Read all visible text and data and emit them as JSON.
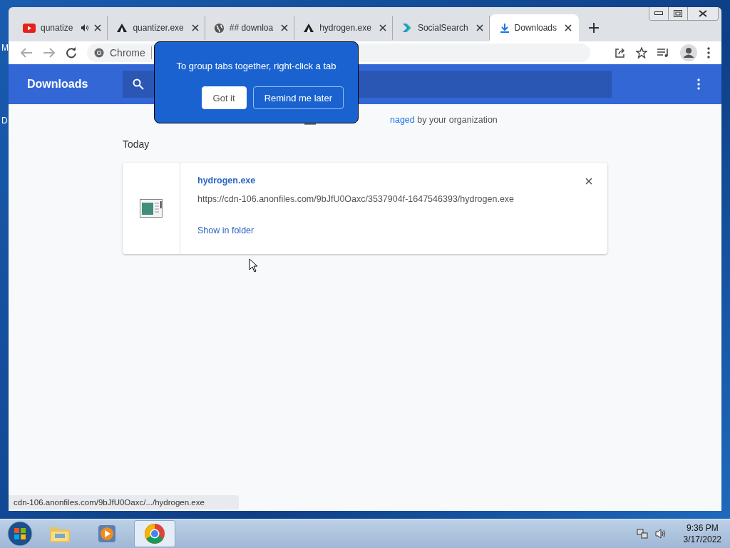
{
  "desktop": {
    "icon_labels": [
      "M",
      "D"
    ]
  },
  "tabs": [
    {
      "title": "qunatize",
      "kind": "video",
      "audio": true,
      "selected": false
    },
    {
      "title": "quantizer.exe",
      "kind": "tent",
      "audio": false,
      "selected": false
    },
    {
      "title": "## downloa",
      "kind": "globe",
      "audio": false,
      "selected": false
    },
    {
      "title": "hydrogen.exe",
      "kind": "tent",
      "audio": false,
      "selected": false
    },
    {
      "title": "SocialSearch",
      "kind": "chevron",
      "audio": false,
      "selected": false
    },
    {
      "title": "Downloads",
      "kind": "download",
      "audio": false,
      "selected": true
    }
  ],
  "toolbar": {
    "site_chip": "Chrome"
  },
  "promo": {
    "message": "To group tabs together, right-click a tab",
    "buttons": [
      "Got it",
      "Remind me later"
    ]
  },
  "page": {
    "title": "Downloads",
    "managed_link": "naged",
    "managed_text": "by your organization",
    "section": "Today",
    "downloads": [
      {
        "file_name": "hydrogen.exe",
        "url": "https://cdn-106.anonfiles.com/9bJfU0Oaxc/3537904f-1647546393/hydrogen.exe",
        "action": "Show in folder"
      }
    ]
  },
  "status_bubble": "cdn-106.anonfiles.com/9bJfU0Oaxc/.../hydrogen.exe",
  "taskbar": {
    "apps": [
      {
        "kind": "explorer",
        "selected": false
      },
      {
        "kind": "media",
        "selected": false
      },
      {
        "kind": "chrome",
        "selected": true
      }
    ],
    "time": "9:36 PM",
    "date": "3/17/2022"
  }
}
